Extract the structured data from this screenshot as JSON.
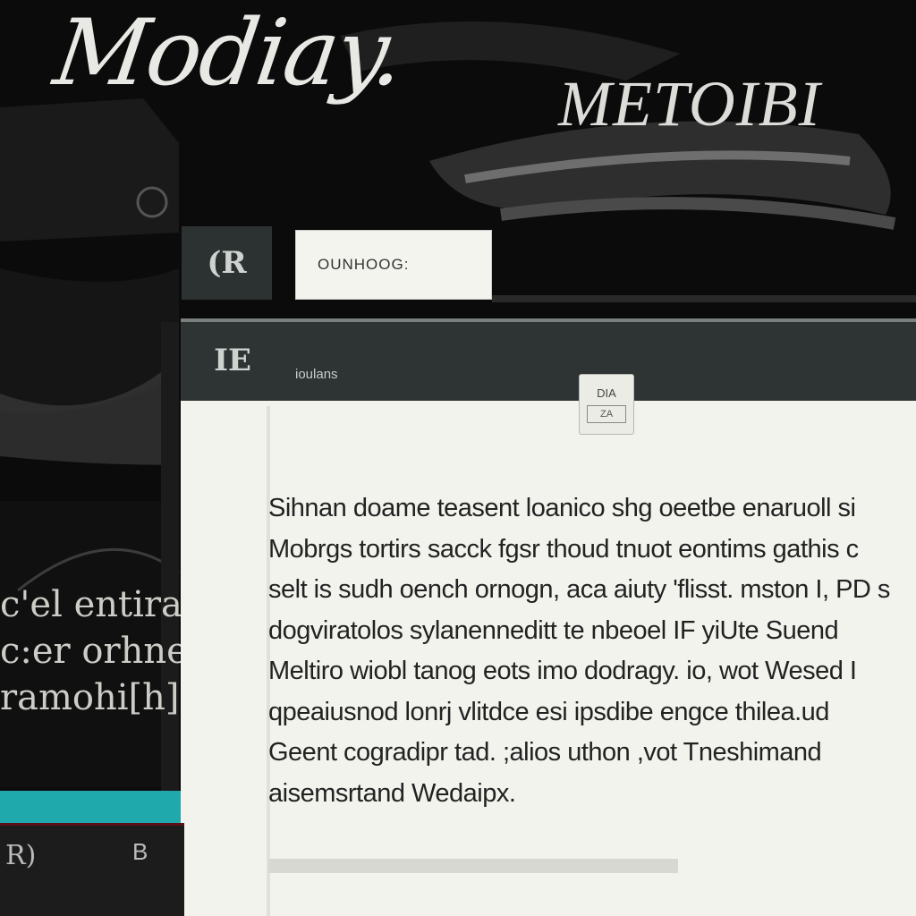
{
  "header": {
    "brand_title": "Modiay.",
    "brand_subtitle": "METOIBI"
  },
  "toolbar": {
    "icon_glyph": "(R",
    "icon_name": "app-icon",
    "search_value": "OUNHOOG:"
  },
  "panel": {
    "icon_glyph": "IE",
    "label": "ioulans"
  },
  "float_button": {
    "label": "DIA",
    "icon_glyph": "ZA"
  },
  "document": {
    "lines": [
      "Sihnan doame teasent loanico shg oeetbe enaruoll si",
      "Mobrgs tortirs sacck fgsr thoud tnuot eontims gathis c",
      "selt is sudh oench ornogn, aca aiuty 'flisst. mston I, PD s",
      "dogviratolos sylanenneditt te nbeoel IF yiUte Suend",
      "Meltiro wiobl tanog eots imo dodragy. io, wot Wesed I",
      "qpeaiusnod lonrj vlitdce esi ipsdibe engce thilea.ud",
      "Geent cogradipr tad. ;alios uthon ,vot Tneshimand",
      "aisemsrtand Wedaipx."
    ]
  },
  "sidebar": {
    "text_lines": [
      "c'el entira,",
      "c:er orhnee",
      "ramohi[h]"
    ],
    "bottom_glyph": "R)",
    "bottom_mark": "B"
  },
  "colors": {
    "accent_teal": "#1fa9ad",
    "panel_header": "#2d3433",
    "content_bg": "#f3f3ee"
  }
}
